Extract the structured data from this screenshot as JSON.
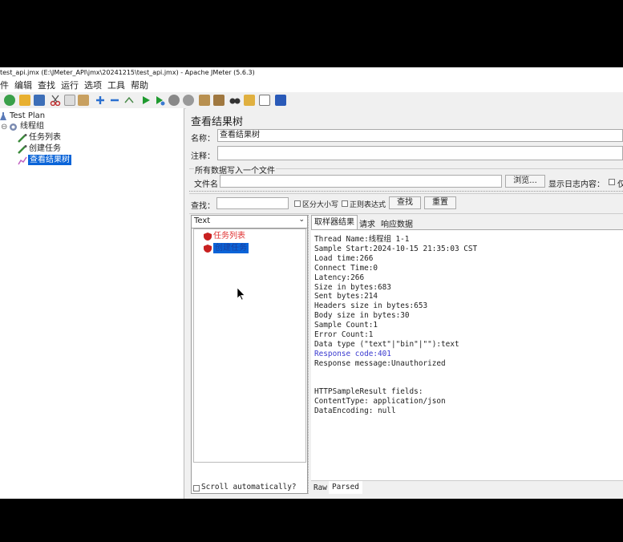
{
  "window": {
    "title": "test_api.jmx (E:\\JMeter_API\\jmx\\20241215\\test_api.jmx) - Apache JMeter (5.6.3)"
  },
  "menu": [
    "件",
    "编辑",
    "查找",
    "运行",
    "选项",
    "工具",
    "帮助"
  ],
  "tree": {
    "root": "Test Plan",
    "thread_group": "线程组",
    "children": [
      "任务列表",
      "创建任务",
      "查看结果树"
    ]
  },
  "panel": {
    "title": "查看结果树",
    "name_label": "名称：",
    "name_value": "查看结果树",
    "comment_label": "注释：",
    "comment_value": "",
    "file_section": "所有数据写入一个文件",
    "filename_label": "文件名",
    "filename_value": "",
    "browse_button": "浏览...",
    "log_label": "显示日志内容：",
    "only_label": "仅"
  },
  "search": {
    "label": "查找：",
    "value": "",
    "case_sensitive": "区分大小写",
    "regex": "正则表达式",
    "find_button": "查找",
    "reset_button": "重置"
  },
  "results": {
    "renderer": "Text",
    "samples": [
      {
        "name": "任务列表",
        "status": "error",
        "selected": false
      },
      {
        "name": "创建任务",
        "status": "error",
        "selected": true
      }
    ],
    "scroll_auto": "Scroll automatically?"
  },
  "tabs": [
    "取样器结果",
    "请求",
    "响应数据"
  ],
  "sample_result": [
    {
      "text": "Thread Name:线程组 1-1"
    },
    {
      "text": "Sample Start:2024-10-15 21:35:03 CST"
    },
    {
      "text": "Load time:266"
    },
    {
      "text": "Connect Time:0"
    },
    {
      "text": "Latency:266"
    },
    {
      "text": "Size in bytes:683"
    },
    {
      "text": "Sent bytes:214"
    },
    {
      "text": "Headers size in bytes:653"
    },
    {
      "text": "Body size in bytes:30"
    },
    {
      "text": "Sample Count:1"
    },
    {
      "text": "Error Count:1"
    },
    {
      "text": "Data type (\"text\"|\"bin\"|\"\"):text"
    },
    {
      "text": "Response code:401",
      "color": "#3a3ad0"
    },
    {
      "text": "Response message:Unauthorized"
    },
    {
      "text": ""
    },
    {
      "text": ""
    },
    {
      "text": "HTTPSampleResult fields:"
    },
    {
      "text": "ContentType: application/json"
    },
    {
      "text": "DataEncoding: null"
    }
  ],
  "bottom_tabs": [
    "Raw",
    "Parsed"
  ],
  "colors": {
    "selection": "#0a64d8",
    "error_text": "#e03030",
    "response_code": "#3a3ad0"
  }
}
